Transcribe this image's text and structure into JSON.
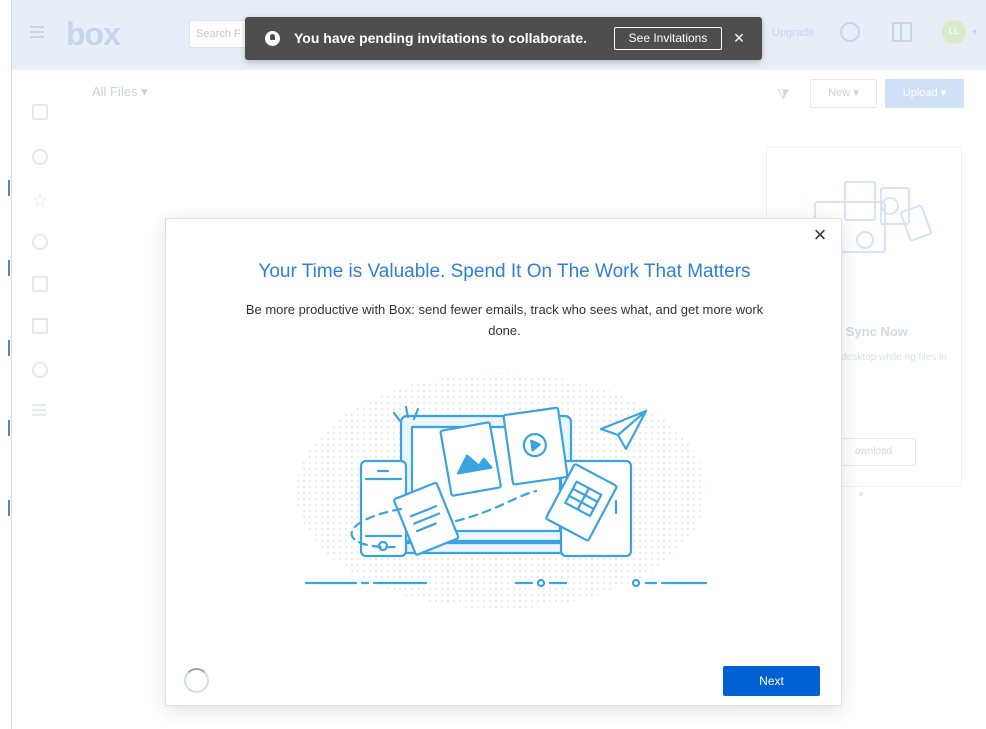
{
  "header": {
    "logo": "box",
    "search_placeholder": "Search F",
    "upgrade_label": "Upgrade",
    "avatar_initials": "LL",
    "avatar_caret": "▾"
  },
  "toast": {
    "message": "You have pending invitations to collaborate.",
    "button_label": "See Invitations",
    "close_glyph": "×"
  },
  "toolbar": {
    "breadcrumb": "All Files ▾",
    "new_label": "New ▾",
    "upload_label": "Upload ▾"
  },
  "nav": {
    "favorites_glyph": "☆"
  },
  "sync_card": {
    "title": "ox Sync Now",
    "description": "your desktop while ng files in sync",
    "button_label": "ownload"
  },
  "modal": {
    "close_glyph": "×",
    "title": "Your Time is Valuable. Spend It On The Work That Matters",
    "subtitle": "Be more productive with Box: send fewer emails, track who sees what, and get more work done.",
    "next_label": "Next"
  },
  "colors": {
    "accent_blue": "#2f7ed8",
    "button_blue": "#0061d5",
    "toast_bg": "#4e4e4e",
    "header_bg": "#e8eef8"
  }
}
